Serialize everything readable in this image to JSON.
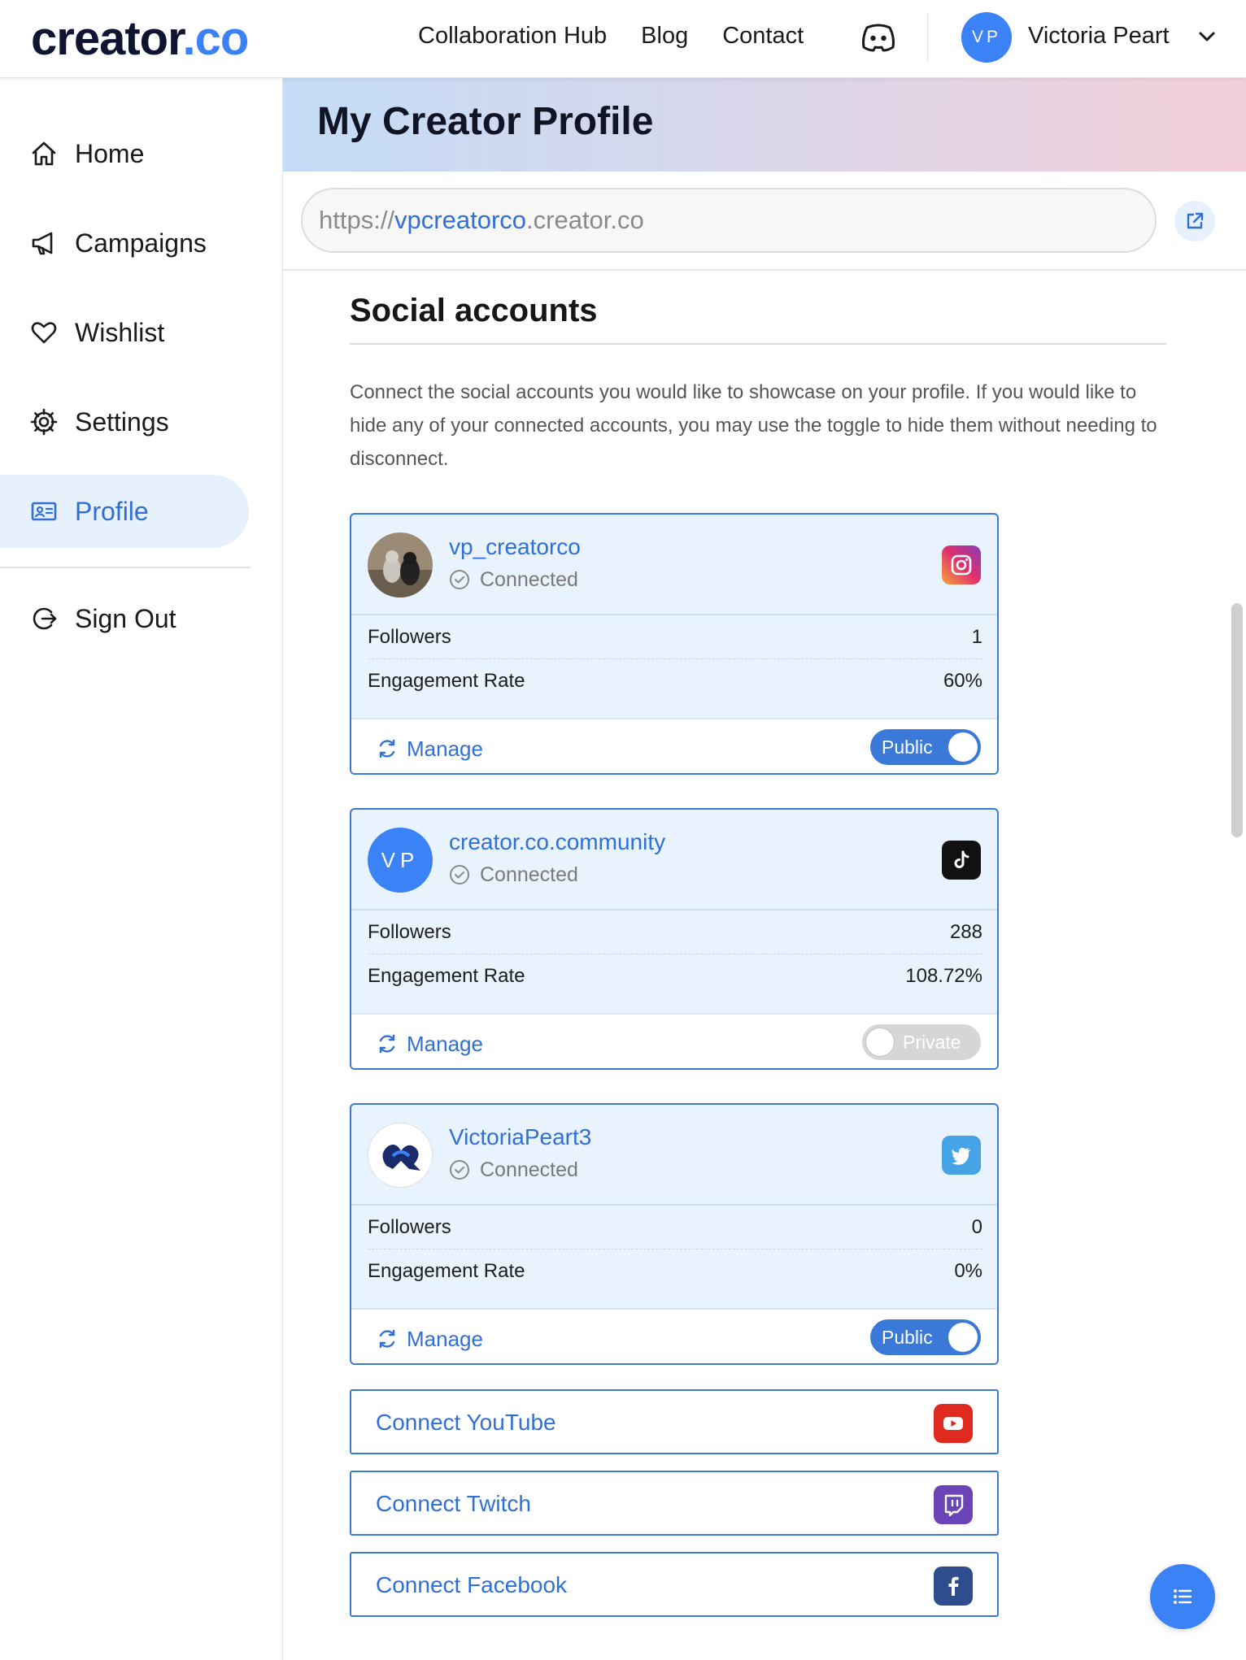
{
  "brand": {
    "logo_text": "creator",
    "logo_suffix": ".co",
    "accent": "#3b82f6"
  },
  "topnav": {
    "links": [
      "Collaboration Hub",
      "Blog",
      "Contact"
    ],
    "discord_icon": "discord-icon",
    "user": {
      "initials": "VP",
      "name": "Victoria Peart"
    }
  },
  "sidebar": {
    "items": [
      {
        "label": "Home",
        "icon": "home-icon"
      },
      {
        "label": "Campaigns",
        "icon": "megaphone-icon"
      },
      {
        "label": "Wishlist",
        "icon": "heart-icon"
      },
      {
        "label": "Settings",
        "icon": "gear-icon"
      },
      {
        "label": "Profile",
        "icon": "id-card-icon",
        "active": true
      },
      {
        "label": "Sign Out",
        "icon": "sign-out-icon"
      }
    ]
  },
  "header": {
    "title": "My Creator Profile"
  },
  "profile_url": {
    "prefix": "https://",
    "handle": "vpcreatorco",
    "suffix": ".creator.co"
  },
  "social": {
    "title": "Social accounts",
    "description": "Connect the social accounts you would like to showcase on your profile. If you would like to hide any of your connected accounts, you may use the toggle to hide them without needing to disconnect.",
    "accounts": [
      {
        "handle": "vp_creatorco",
        "status": "Connected",
        "platform": "instagram",
        "followers_label": "Followers",
        "followers": "1",
        "engagement_label": "Engagement Rate",
        "engagement": "60%",
        "manage_label": "Manage",
        "visibility": "Public"
      },
      {
        "handle": "creator.co.community",
        "status": "Connected",
        "platform": "tiktok",
        "avatar_initials": "VP",
        "followers_label": "Followers",
        "followers": "288",
        "engagement_label": "Engagement Rate",
        "engagement": "108.72%",
        "manage_label": "Manage",
        "visibility": "Private"
      },
      {
        "handle": "VictoriaPeart3",
        "status": "Connected",
        "platform": "twitter",
        "followers_label": "Followers",
        "followers": "0",
        "engagement_label": "Engagement Rate",
        "engagement": "0%",
        "manage_label": "Manage",
        "visibility": "Public"
      }
    ],
    "connect": [
      {
        "label": "Connect YouTube",
        "icon": "youtube-icon",
        "color": "#e02a1f"
      },
      {
        "label": "Connect Twitch",
        "icon": "twitch-icon",
        "color": "#6b45b8"
      },
      {
        "label": "Connect Facebook",
        "icon": "facebook-icon",
        "color": "#2f4c8c"
      }
    ]
  }
}
